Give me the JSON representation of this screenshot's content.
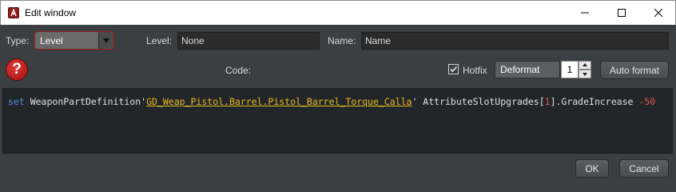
{
  "window": {
    "title": "Edit window"
  },
  "controls": {
    "type_label": "Type:",
    "type_value": "Level",
    "level_label": "Level:",
    "level_value": "None",
    "name_label": "Name:",
    "name_value": "Name",
    "code_label": "Code:",
    "hotfix_label": "Hotfix",
    "hotfix_checked": true,
    "format_value": "Deformat",
    "spinner_value": "1",
    "auto_format_label": "Auto format",
    "help_icon": "help-icon"
  },
  "code": {
    "keyword": "set",
    "class": " WeaponPartDefinition'",
    "path": "GD_Weap_Pistol.Barrel.Pistol_Barrel_Torque_Calla",
    "after_path": "' AttributeSlotUpgrades[",
    "index": "1",
    "after_index": "].GradeIncrease ",
    "value": "-50"
  },
  "footer": {
    "ok_label": "OK",
    "cancel_label": "Cancel"
  },
  "colors": {
    "keyword": "#5c8fe0",
    "path": "#e8b923",
    "number": "#e15252",
    "type_select_border": "#a11d1d"
  }
}
